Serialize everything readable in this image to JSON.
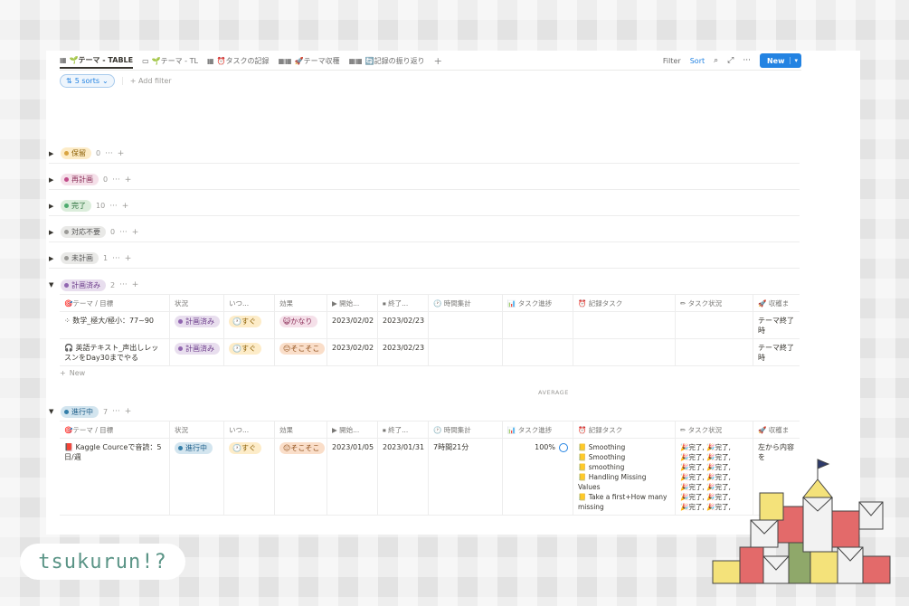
{
  "views": {
    "tabs": [
      {
        "icon": "▦",
        "label": "🌱テーマ - TABLE",
        "active": true
      },
      {
        "icon": "▭",
        "label": "🌱テーマ - TL",
        "active": false
      },
      {
        "icon": "▦",
        "label": "⏰タスクの記録",
        "active": false
      },
      {
        "icon": "▦▦",
        "label": "🚀テーマ収穫",
        "active": false
      },
      {
        "icon": "▦▦",
        "label": "🔄記録の振り返り",
        "active": false
      }
    ],
    "add": "+",
    "filter_label": "Filter",
    "sort_label": "Sort",
    "new_label": "New"
  },
  "filters": {
    "sorts_label": "5 sorts",
    "add_filter_label": "Add filter"
  },
  "groups": [
    {
      "label": "保留",
      "count": "0",
      "style": "yellow"
    },
    {
      "label": "再計画",
      "count": "0",
      "style": "pink"
    },
    {
      "label": "完了",
      "count": "10",
      "style": "green"
    },
    {
      "label": "対応不要",
      "count": "0",
      "style": "gray"
    },
    {
      "label": "未計画",
      "count": "1",
      "style": "gray"
    },
    {
      "label": "計画済み",
      "count": "2",
      "style": "purple"
    },
    {
      "label": "進行中",
      "count": "7",
      "style": "blue"
    }
  ],
  "columns": [
    "🎯テーマ / 目標",
    "状況",
    "いつ...",
    "効果",
    "▶ 開始...",
    "⏹ 終了...",
    "🕐 時間集計",
    "📊 タスク進捗",
    "⏰ 記録タスク",
    "✏ タスク状況",
    "🚀 収穫ま"
  ],
  "planned_rows": [
    {
      "icon": "⁘",
      "title": "数学_極大/極小：77~90",
      "status": "計画済み",
      "when": "🕐すぐ",
      "effect": "😺かなり",
      "start": "2023/02/02",
      "end": "2023/02/23",
      "harvest": "テーマ終了時"
    },
    {
      "icon": "🎧",
      "title": "英語テキスト_声出しレッスンをDay30までやる",
      "status": "計画済み",
      "when": "🕐すぐ",
      "effect": "😐そこそこ",
      "start": "2023/02/02",
      "end": "2023/02/23",
      "harvest": "テーマ終了時"
    }
  ],
  "new_row_label": "New",
  "average_label": "AVERAGE",
  "inprogress_row": {
    "icon": "📕",
    "title": "Kaggle Courceで音読：5日/週",
    "status": "進行中",
    "when": "🕐すぐ",
    "effect": "😐そこそこ",
    "start": "2023/01/05",
    "end": "2023/01/31",
    "time": "7時間21分",
    "progress": "100%",
    "tasks": [
      "📒 Smoothing",
      "📒 Smoothing",
      "📒 smoothing",
      "📒 Handling Missing Values",
      "📒 Take a first+How many missing"
    ],
    "task_status": [
      "🎉完了, 🎉完了,",
      "🎉完了, 🎉完了,",
      "🎉完了, 🎉完了,",
      "🎉完了, 🎉完了,",
      "🎉完了, 🎉完了,",
      "🎉完了, 🎉完了,",
      "🎉完了, 🎉完了,"
    ],
    "harvest": "左から内容を"
  },
  "logo_text": "tsukurun!?",
  "colors": {
    "accent": "#2383e2",
    "logo": "#5a9486"
  }
}
